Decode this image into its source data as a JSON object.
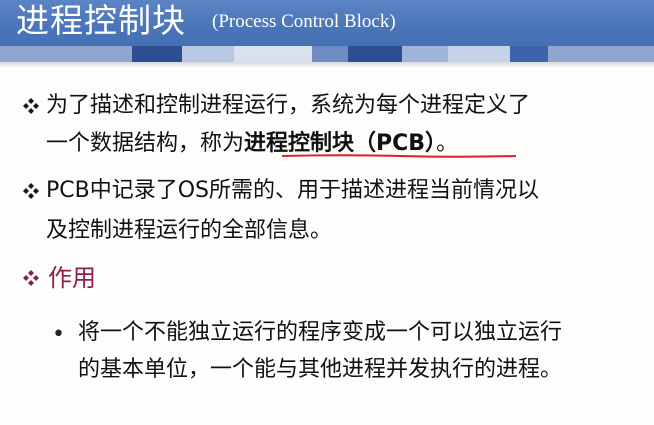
{
  "header": {
    "title": "进程控制块",
    "title_en": "(Process Control Block)"
  },
  "bullets": [
    {
      "line1": "为了描述和控制进程运行，系统为每个进程定义了",
      "line2_prefix": "一个数据结构，称为",
      "term": "进程控制块（PCB）",
      "line2_suffix": "。"
    },
    {
      "line1": "PCB中记录了OS所需的、用于描述进程当前情况以",
      "line2": "及控制进程运行的全部信息。"
    }
  ],
  "section": {
    "heading": "作用",
    "sub_bullet_symbol": "•",
    "sub_line1": "将一个不能独立运行的程序变成一个可以独立运行",
    "sub_line2": "的基本单位，一个能与其他进程并发执行的进程。"
  },
  "colors": {
    "header_blue": "#4a75b8",
    "text": "#111111",
    "section_heading": "#8b1e4f",
    "underline_red": "#d9222a"
  },
  "icons": {
    "bullet_icon": "four-diamond-bullet-icon",
    "section_icon": "four-diamond-bullet-icon"
  }
}
